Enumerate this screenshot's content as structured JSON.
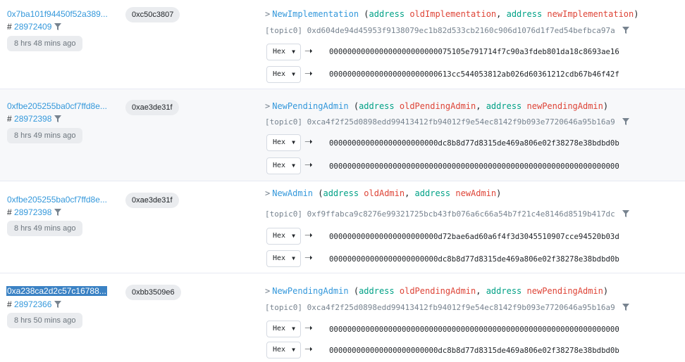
{
  "logs": [
    {
      "tx_hash": "0x7ba101f94450f52a389...",
      "block_prefix": "# ",
      "block": "28972409",
      "age": "8 hrs 48 mins ago",
      "method": "0xc50c3807",
      "event": "NewImplementation",
      "params": [
        {
          "type": "address",
          "name": "oldImplementation"
        },
        {
          "type": "address",
          "name": "newImplementation"
        }
      ],
      "topic_label": "[topic0]",
      "topic0": "0xd604de94d45953f9138079ec1b82d533cb2160c906d1076d1f7ed54befbca97a",
      "data": [
        {
          "format": "Hex",
          "value": "000000000000000000000000075105e791714f7c90a3fdeb801da18c8693ae16"
        },
        {
          "format": "Hex",
          "value": "000000000000000000000000613cc544053812ab026d60361212cdb67b46f42f"
        }
      ]
    },
    {
      "tx_hash": "0xfbe205255ba0cf7ffd8e...",
      "block_prefix": "# ",
      "block": "28972398",
      "age": "8 hrs 49 mins ago",
      "method": "0xae3de31f",
      "event": "NewPendingAdmin",
      "params": [
        {
          "type": "address",
          "name": "oldPendingAdmin"
        },
        {
          "type": "address",
          "name": "newPendingAdmin"
        }
      ],
      "topic_label": "[topic0]",
      "topic0": "0xca4f2f25d0898edd99413412fb94012f9e54ec8142f9b093e7720646a95b16a9",
      "data": [
        {
          "format": "Hex",
          "value": "000000000000000000000000dc8b8d77d8315de469a806e02f38278e38bdbd0b"
        },
        {
          "format": "Hex",
          "value": "0000000000000000000000000000000000000000000000000000000000000000"
        }
      ]
    },
    {
      "tx_hash": "0xfbe205255ba0cf7ffd8e...",
      "block_prefix": "# ",
      "block": "28972398",
      "age": "8 hrs 49 mins ago",
      "method": "0xae3de31f",
      "event": "NewAdmin",
      "params": [
        {
          "type": "address",
          "name": "oldAdmin"
        },
        {
          "type": "address",
          "name": "newAdmin"
        }
      ],
      "topic_label": "[topic0]",
      "topic0": "0xf9ffabca9c8276e99321725bcb43fb076a6c66a54b7f21c4e8146d8519b417dc",
      "data": [
        {
          "format": "Hex",
          "value": "000000000000000000000000d72bae6ad60a6f4f3d3045510907cce94520b03d"
        },
        {
          "format": "Hex",
          "value": "000000000000000000000000dc8b8d77d8315de469a806e02f38278e38bdbd0b"
        }
      ]
    },
    {
      "tx_hash": "0xa238ca2d2c57c16788...",
      "block_prefix": "# ",
      "block": "28972366",
      "age": "8 hrs 50 mins ago",
      "method": "0xbb3509e6",
      "event": "NewPendingAdmin",
      "params": [
        {
          "type": "address",
          "name": "oldPendingAdmin"
        },
        {
          "type": "address",
          "name": "newPendingAdmin"
        }
      ],
      "topic_label": "[topic0]",
      "topic0": "0xca4f2f25d0898edd99413412fb94012f9e54ec8142f9b093e7720646a95b16a9",
      "data": [
        {
          "format": "Hex",
          "value": "0000000000000000000000000000000000000000000000000000000000000000"
        },
        {
          "format": "Hex",
          "value": "000000000000000000000000dc8b8d77d8315de469a806e02f38278e38bdbd0b"
        }
      ]
    }
  ],
  "icons": {
    "filter": "filter-icon",
    "arrow": "arrow-right-icon",
    "caret": "chevron-down-icon",
    "chevron": "chevron-right-icon"
  },
  "colors": {
    "link": "#3498db",
    "keyword": "#00a186",
    "param": "#de4437",
    "selection": "#3b82c4"
  }
}
